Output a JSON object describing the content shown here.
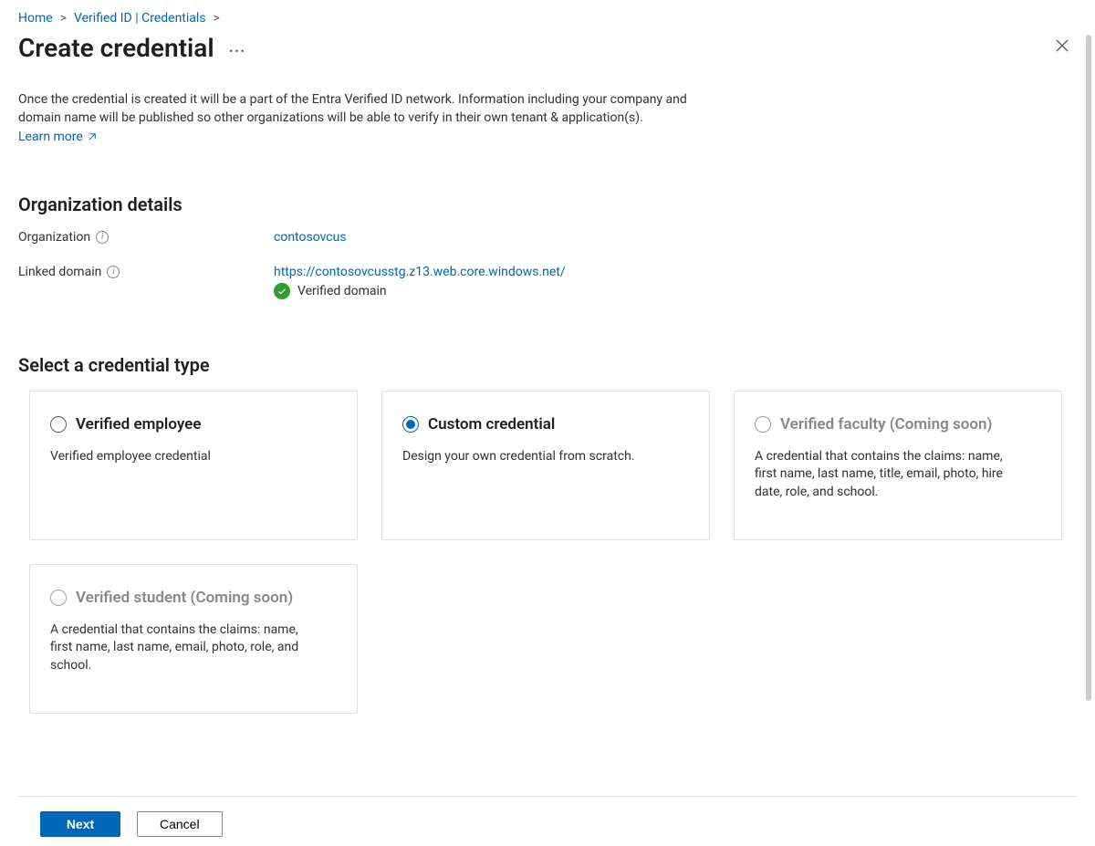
{
  "breadcrumb": {
    "home": "Home",
    "verified": "Verified ID | Credentials"
  },
  "page_title": "Create credential",
  "intro_text": "Once the credential is created it will be a part of the Entra Verified ID network. Information including your company and domain name will be published so other organizations will be able to verify in their own tenant & application(s).",
  "learn_more": "Learn more",
  "org_section": {
    "heading": "Organization details",
    "org_label": "Organization",
    "org_value": "contosovcus",
    "domain_label": "Linked domain",
    "domain_value": "https://contosovcusstg.z13.web.core.windows.net/",
    "verified_text": "Verified domain"
  },
  "select_heading": "Select a credential type",
  "cards": {
    "employee": {
      "title": "Verified employee",
      "desc": "Verified employee credential"
    },
    "custom": {
      "title": "Custom credential",
      "desc": "Design your own credential from scratch."
    },
    "faculty": {
      "title": "Verified faculty (Coming soon)",
      "desc": "A credential that contains the claims: name, first name, last name, title, email, photo, hire date, role, and school."
    },
    "student": {
      "title": "Verified student (Coming soon)",
      "desc": "A credential that contains the claims: name, first name, last name, email, photo, role, and school."
    }
  },
  "buttons": {
    "next": "Next",
    "cancel": "Cancel"
  }
}
